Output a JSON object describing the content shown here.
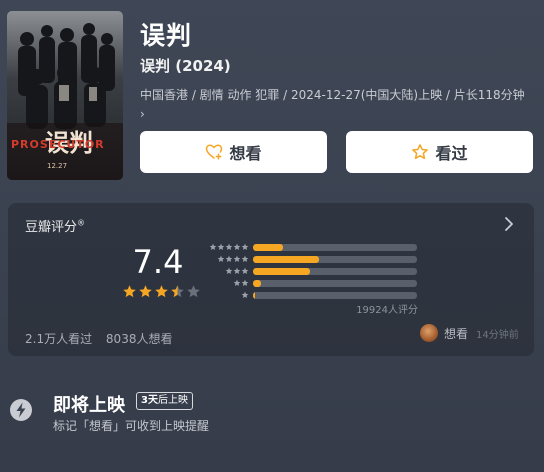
{
  "movie": {
    "poster_title": "误判",
    "poster_text_en": "PROSECUTOR",
    "poster_date": "12.27",
    "title": "误判",
    "subtitle": "误判 (2024)",
    "meta": "中国香港 / 剧情 动作 犯罪 / 2024-12-27(中国大陆)上映 / 片长118分钟 ›"
  },
  "actions": {
    "want_label": "想看",
    "seen_label": "看过"
  },
  "rating": {
    "title": "豆瓣评分",
    "title_mark": "®",
    "score": "7.4",
    "stars": 3.5,
    "distribution": [
      {
        "stars": 5,
        "fraction": 0.18
      },
      {
        "stars": 4,
        "fraction": 0.4
      },
      {
        "stars": 3,
        "fraction": 0.35
      },
      {
        "stars": 2,
        "fraction": 0.05
      },
      {
        "stars": 1,
        "fraction": 0.01
      }
    ],
    "count_text": "19924人评分",
    "seen_count": "2.1万人看过",
    "want_count": "8038人想看",
    "activity_action": "想看",
    "activity_time": "14分钟前"
  },
  "release": {
    "title": "即将上映",
    "badge_days": "3天",
    "badge_text": "后上映",
    "description": "标记「想看」可收到上映提醒"
  },
  "colors": {
    "star": "#f5a623",
    "bar_track": "#5a606b",
    "button_bg": "#ffffff",
    "want_icon": "#f5a623"
  }
}
